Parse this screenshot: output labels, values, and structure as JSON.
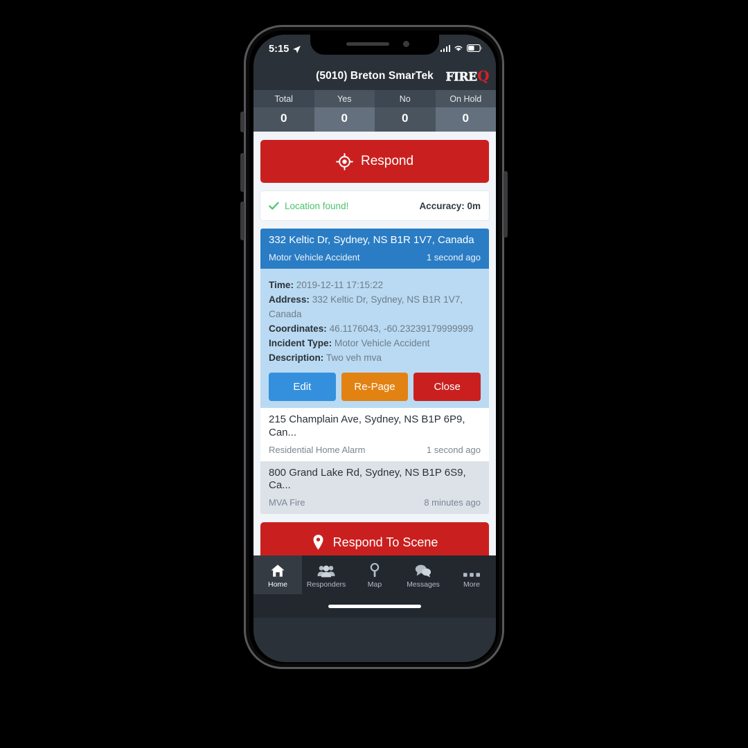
{
  "status_bar": {
    "time": "5:15",
    "location_arrow_icon": "location-arrow-icon",
    "signal_icon": "signal-bars-icon",
    "wifi_icon": "wifi-icon",
    "battery_icon": "battery-icon"
  },
  "header": {
    "title": "(5010) Breton SmarTek",
    "brand_fire": "FIRE",
    "brand_q": "Q"
  },
  "stats": [
    {
      "label": "Total",
      "value": "0"
    },
    {
      "label": "Yes",
      "value": "0"
    },
    {
      "label": "No",
      "value": "0"
    },
    {
      "label": "On Hold",
      "value": "0"
    }
  ],
  "respond_button": {
    "label": "Respond",
    "icon": "crosshair-target-icon"
  },
  "location_bar": {
    "check_icon": "check-icon",
    "status": "Location found!",
    "accuracy": "Accuracy: 0m"
  },
  "incidents": [
    {
      "address": "332 Keltic Dr, Sydney, NS B1R 1V7, Canada",
      "type": "Motor Vehicle Accident",
      "age": "1 second ago",
      "selected": true,
      "details": {
        "time_label": "Time:",
        "time_value": "2019-12-11 17:15:22",
        "address_label": "Address:",
        "address_value": "332 Keltic Dr, Sydney, NS B1R 1V7, Canada",
        "coordinates_label": "Coordinates:",
        "coordinates_value": "46.1176043, -60.23239179999999",
        "incident_type_label": "Incident Type:",
        "incident_type_value": "Motor Vehicle Accident",
        "description_label": "Description:",
        "description_value": "Two veh mva"
      },
      "actions": {
        "edit": "Edit",
        "repage": "Re-Page",
        "close": "Close"
      }
    },
    {
      "address": "215 Champlain Ave, Sydney, NS B1P 6P9, Can...",
      "type": "Residential Home Alarm",
      "age": "1 second ago",
      "selected": false
    },
    {
      "address": "800 Grand Lake Rd, Sydney, NS B1P 6S9, Ca...",
      "type": "MVA Fire",
      "age": "8 minutes ago",
      "selected": false
    }
  ],
  "respond_scene_button": {
    "label": "Respond To Scene",
    "icon": "map-pin-icon"
  },
  "tabs": [
    {
      "label": "Home",
      "icon": "home-icon",
      "active": true
    },
    {
      "label": "Responders",
      "icon": "people-icon",
      "active": false
    },
    {
      "label": "Map",
      "icon": "map-pin-icon",
      "active": false
    },
    {
      "label": "Messages",
      "icon": "chat-icon",
      "active": false
    },
    {
      "label": "More",
      "icon": "ellipsis-icon",
      "active": false
    }
  ],
  "colors": {
    "red": "#c9201f",
    "blue": "#2a7dc4",
    "orange": "#e28213",
    "green": "#49c36c",
    "dark": "#2b3138"
  }
}
